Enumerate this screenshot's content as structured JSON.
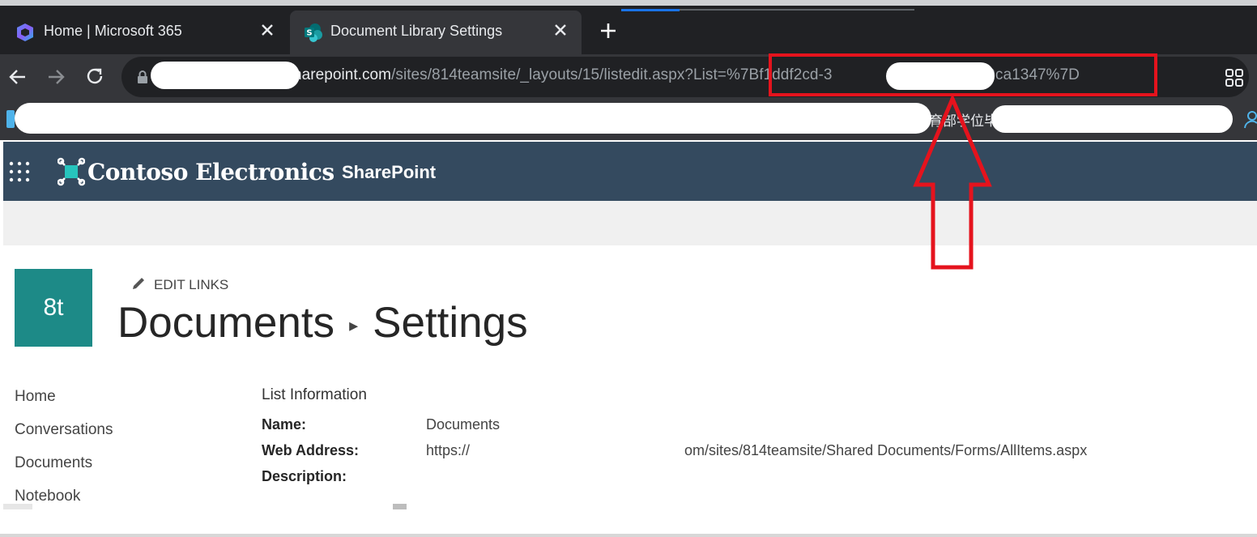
{
  "browser": {
    "tabs": [
      {
        "label": "Home | Microsoft 365",
        "icon": "microsoft-365-icon"
      },
      {
        "label": "Document Library Settings",
        "icon": "sharepoint-icon"
      }
    ],
    "new_tab_label": "+",
    "url": {
      "host_visible": "harepoint.com",
      "path": "/sites/814teamsite/_layouts/15/listedit.aspx?List=",
      "list_id_start": "%7Bf1ddf2cd-3",
      "list_id_end": "a-31fe09ca1347%7D"
    },
    "bookmark_text": "育部学位毕"
  },
  "suite": {
    "brand": "Contoso Electronics",
    "product": "SharePoint"
  },
  "site": {
    "logo_text": "8t",
    "edit_links": "EDIT LINKS",
    "title_part1": "Documents",
    "title_part2": "Settings"
  },
  "nav": {
    "items": [
      {
        "label": "Home"
      },
      {
        "label": "Conversations"
      },
      {
        "label": "Documents"
      },
      {
        "label": "Notebook"
      }
    ]
  },
  "list_info": {
    "heading": "List Information",
    "name_label": "Name:",
    "name_value": "Documents",
    "web_address_label": "Web Address:",
    "web_address_start": "https://",
    "web_address_end": "om/sites/814teamsite/Shared Documents/Forms/AllItems.aspx",
    "description_label": "Description:"
  },
  "colors": {
    "suite_bar": "#344a5f",
    "site_logo": "#1d8a87",
    "annotation_red": "#e5131d"
  }
}
